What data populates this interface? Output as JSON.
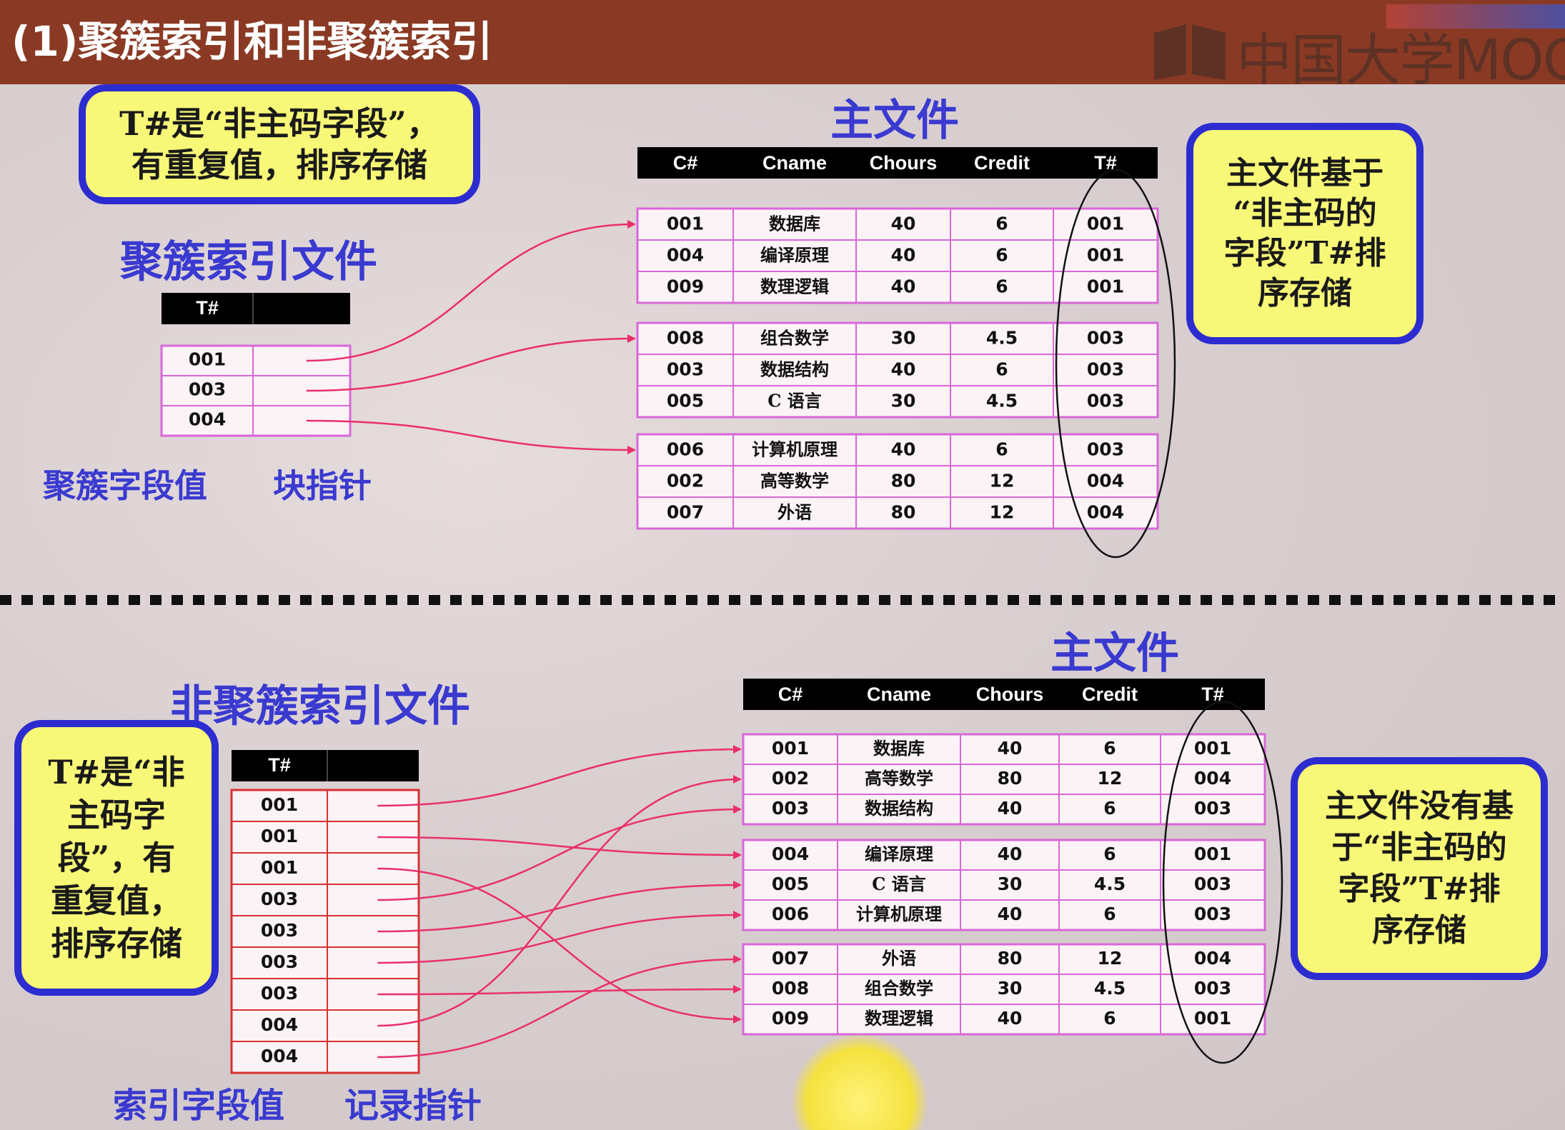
{
  "slide_title": "(1)聚簇索引和非聚簇索引",
  "logo_text": "中国大学MOOC",
  "top": {
    "note": "T#是“非主码字段”，\n有重复值，排序存储",
    "index_title": "聚簇索引文件",
    "index_header": "T#",
    "index_values": [
      "001",
      "003",
      "004"
    ],
    "label_key": "聚簇字段值",
    "label_ptr": "块指针",
    "main_title": "主文件",
    "main_headers": [
      "C#",
      "Cname",
      "Chours",
      "Credit",
      "T#"
    ],
    "main_blocks": [
      [
        [
          "001",
          "数据库",
          "40",
          "6",
          "001"
        ],
        [
          "004",
          "编译原理",
          "40",
          "6",
          "001"
        ],
        [
          "009",
          "数理逻辑",
          "40",
          "6",
          "001"
        ]
      ],
      [
        [
          "008",
          "组合数学",
          "30",
          "4.5",
          "003"
        ],
        [
          "003",
          "数据结构",
          "40",
          "6",
          "003"
        ],
        [
          "005",
          "C 语言",
          "30",
          "4.5",
          "003"
        ]
      ],
      [
        [
          "006",
          "计算机原理",
          "40",
          "6",
          "003"
        ],
        [
          "002",
          "高等数学",
          "80",
          "12",
          "004"
        ],
        [
          "007",
          "外语",
          "80",
          "12",
          "004"
        ]
      ]
    ],
    "side_note": "主文件基于\n“非主码的\n字段”T#排\n序存储",
    "arrows": [
      0,
      1,
      2
    ]
  },
  "bottom": {
    "note": "T#是“非\n主码字\n段”，有\n重复值，\n排序存储",
    "index_title": "非聚簇索引文件",
    "index_header": "T#",
    "index_values": [
      "001",
      "001",
      "001",
      "003",
      "003",
      "003",
      "003",
      "004",
      "004"
    ],
    "label_key": "索引字段值",
    "label_ptr": "记录指针",
    "main_title": "主文件",
    "main_headers": [
      "C#",
      "Cname",
      "Chours",
      "Credit",
      "T#"
    ],
    "main_blocks": [
      [
        [
          "001",
          "数据库",
          "40",
          "6",
          "001"
        ],
        [
          "002",
          "高等数学",
          "80",
          "12",
          "004"
        ],
        [
          "003",
          "数据结构",
          "40",
          "6",
          "003"
        ]
      ],
      [
        [
          "004",
          "编译原理",
          "40",
          "6",
          "001"
        ],
        [
          "005",
          "C 语言",
          "30",
          "4.5",
          "003"
        ],
        [
          "006",
          "计算机原理",
          "40",
          "6",
          "003"
        ]
      ],
      [
        [
          "007",
          "外语",
          "80",
          "12",
          "004"
        ],
        [
          "008",
          "组合数学",
          "30",
          "4.5",
          "003"
        ],
        [
          "009",
          "数理逻辑",
          "40",
          "6",
          "001"
        ]
      ]
    ],
    "side_note": "主文件没有基\n于“非主码的\n字段”T#排\n序存储",
    "arrows": [
      0,
      3,
      8,
      2,
      4,
      5,
      7,
      1,
      6
    ]
  },
  "colors": {
    "title_bar": "#8a3a24",
    "callout_fill": "#f8f878",
    "callout_border": "#2c2cd0",
    "label_blue": "#3a3ad0",
    "grid_pink": "#d868d8",
    "bottom_index_grid": "#d83030",
    "arrow": "#e8306a"
  }
}
